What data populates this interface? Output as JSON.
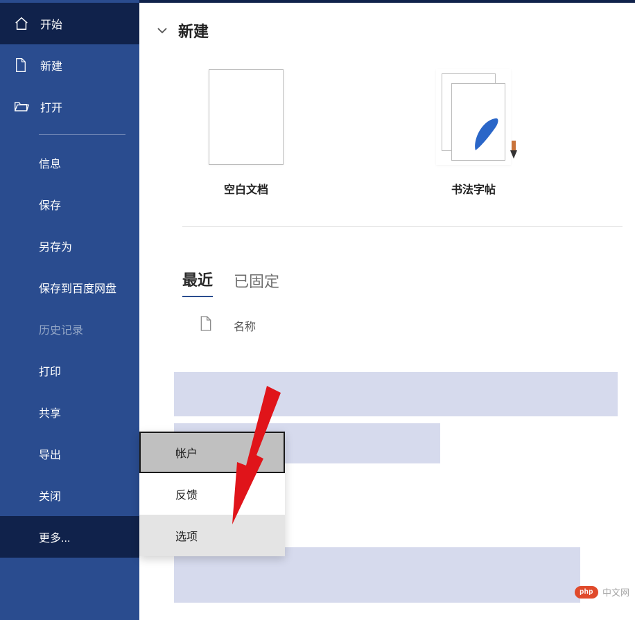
{
  "sidebar": {
    "start": "开始",
    "new": "新建",
    "open": "打开",
    "info": "信息",
    "save": "保存",
    "saveAs": "另存为",
    "saveToBaidu": "保存到百度网盘",
    "history": "历史记录",
    "print": "打印",
    "share": "共享",
    "export": "导出",
    "close": "关闭",
    "more": "更多..."
  },
  "header": {
    "newSection": "新建"
  },
  "templates": {
    "blank": "空白文档",
    "calligraphy": "书法字帖"
  },
  "tabs": {
    "recent": "最近",
    "pinned": "已固定"
  },
  "listHeader": {
    "name": "名称"
  },
  "flyout": {
    "account": "帐户",
    "feedback": "反馈",
    "options": "选项"
  },
  "watermark": {
    "badge": "php",
    "text": "中文网"
  }
}
